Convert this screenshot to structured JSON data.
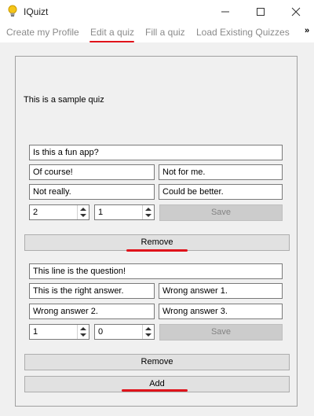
{
  "window": {
    "title": "IQuizt",
    "icon": "lightbulb-icon",
    "accent_color": "#e0131b"
  },
  "tabs": [
    {
      "label": "Create my Profile"
    },
    {
      "label": "Edit a quiz",
      "selected": true
    },
    {
      "label": "Fill a quiz"
    },
    {
      "label": "Load Existing Quizzes"
    }
  ],
  "tabs_more": "»",
  "quiz": {
    "title": "This is a sample quiz",
    "questions": [
      {
        "question": "Is this a fun app?",
        "answers": [
          "Of course!",
          "Not for me.",
          "Not really.",
          "Could be better."
        ],
        "spin1": "2",
        "spin2": "1",
        "save_label": "Save",
        "remove_label": "Remove"
      },
      {
        "question": "This line is the question!",
        "answers": [
          "This is the right answer.",
          "Wrong answer 1.",
          "Wrong answer 2.",
          "Wrong answer 3."
        ],
        "spin1": "1",
        "spin2": "0",
        "save_label": "Save",
        "remove_label": "Remove"
      }
    ],
    "add_label": "Add"
  }
}
